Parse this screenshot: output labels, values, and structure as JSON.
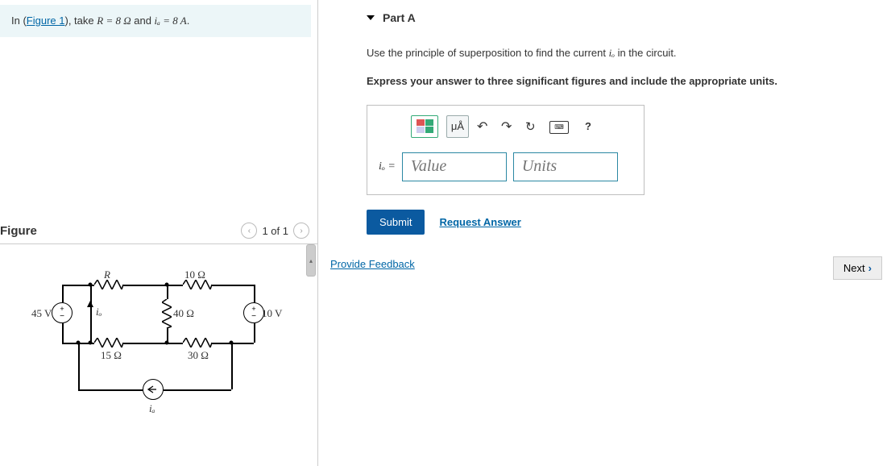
{
  "instruction": {
    "prefix": "In (",
    "figure_link": "Figure 1",
    "suffix_before_math": "), take ",
    "R_eq": "R = 8 Ω",
    "and": " and ",
    "ia_eq": "iₐ = 8 A",
    "period": "."
  },
  "figure": {
    "title": "Figure",
    "nav_text": "1 of 1",
    "labels": {
      "R": "R",
      "r10": "10 Ω",
      "r40": "40 Ω",
      "r15": "15 Ω",
      "r30": "30 Ω",
      "v45": "45 V",
      "v10": "10 V",
      "io": "iₒ",
      "ia": "iₐ"
    }
  },
  "part": {
    "title": "Part A",
    "prompt_1_before": "Use the principle of superposition to find the current ",
    "prompt_io": "iₒ",
    "prompt_1_after": " in the circuit.",
    "prompt_2": "Express your answer to three significant figures and include the appropriate units.",
    "toolbar": {
      "mu": "μÅ",
      "help": "?"
    },
    "eq_label": "iₒ =",
    "value_placeholder": "Value",
    "units_placeholder": "Units",
    "submit": "Submit",
    "request_answer": "Request Answer"
  },
  "feedback": "Provide Feedback",
  "next": "Next"
}
